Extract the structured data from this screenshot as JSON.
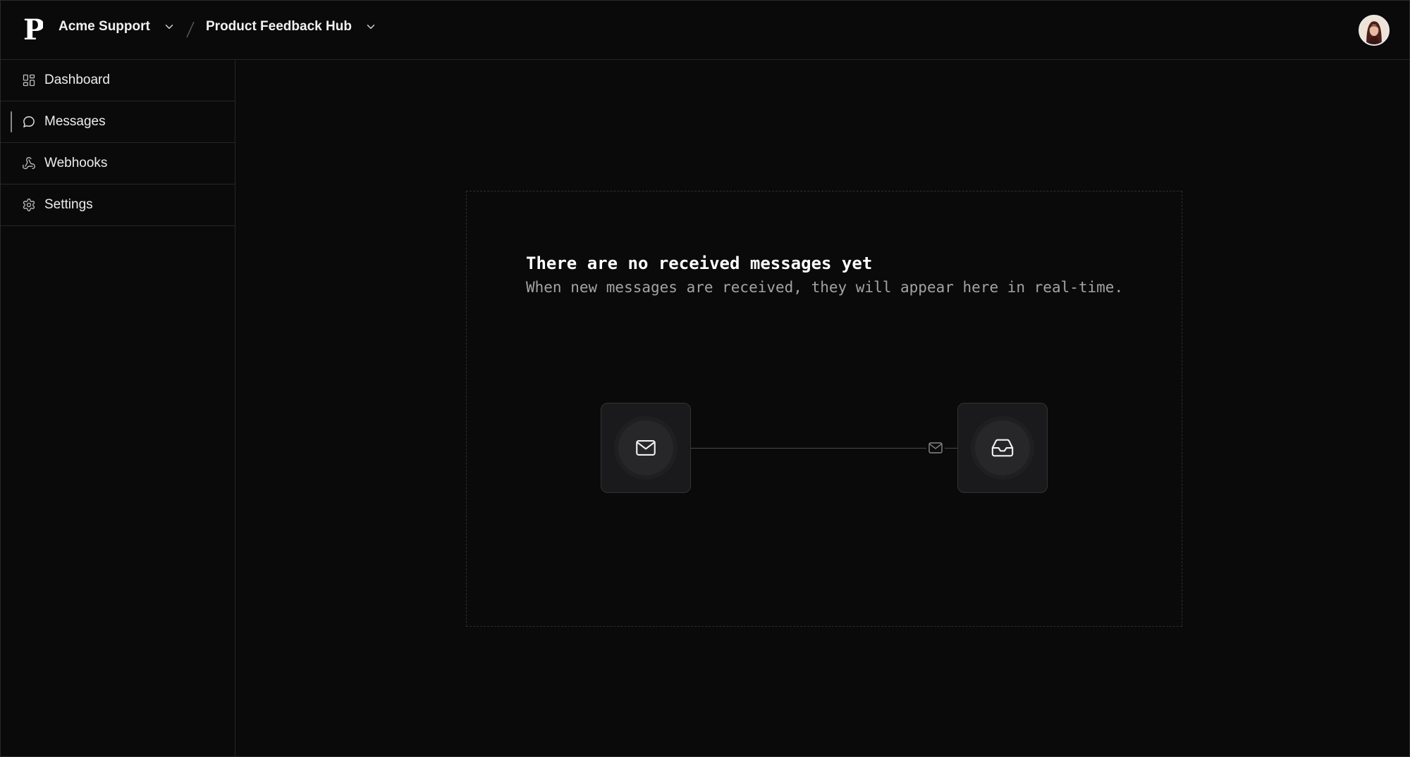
{
  "header": {
    "org_name": "Acme Support",
    "project_name": "Product Feedback Hub",
    "logo_letter": "P"
  },
  "sidebar": {
    "items": [
      {
        "label": "Dashboard",
        "icon": "dashboard-icon",
        "active": false
      },
      {
        "label": "Messages",
        "icon": "message-icon",
        "active": true
      },
      {
        "label": "Webhooks",
        "icon": "webhook-icon",
        "active": false
      },
      {
        "label": "Settings",
        "icon": "gear-icon",
        "active": false
      }
    ]
  },
  "empty_state": {
    "title": "There are no received messages yet",
    "description": "When new messages are received, they will appear here in real-time."
  },
  "colors": {
    "background": "#0a0a0a",
    "border": "#262626",
    "text": "#ededed",
    "muted": "#a3a3a3"
  }
}
